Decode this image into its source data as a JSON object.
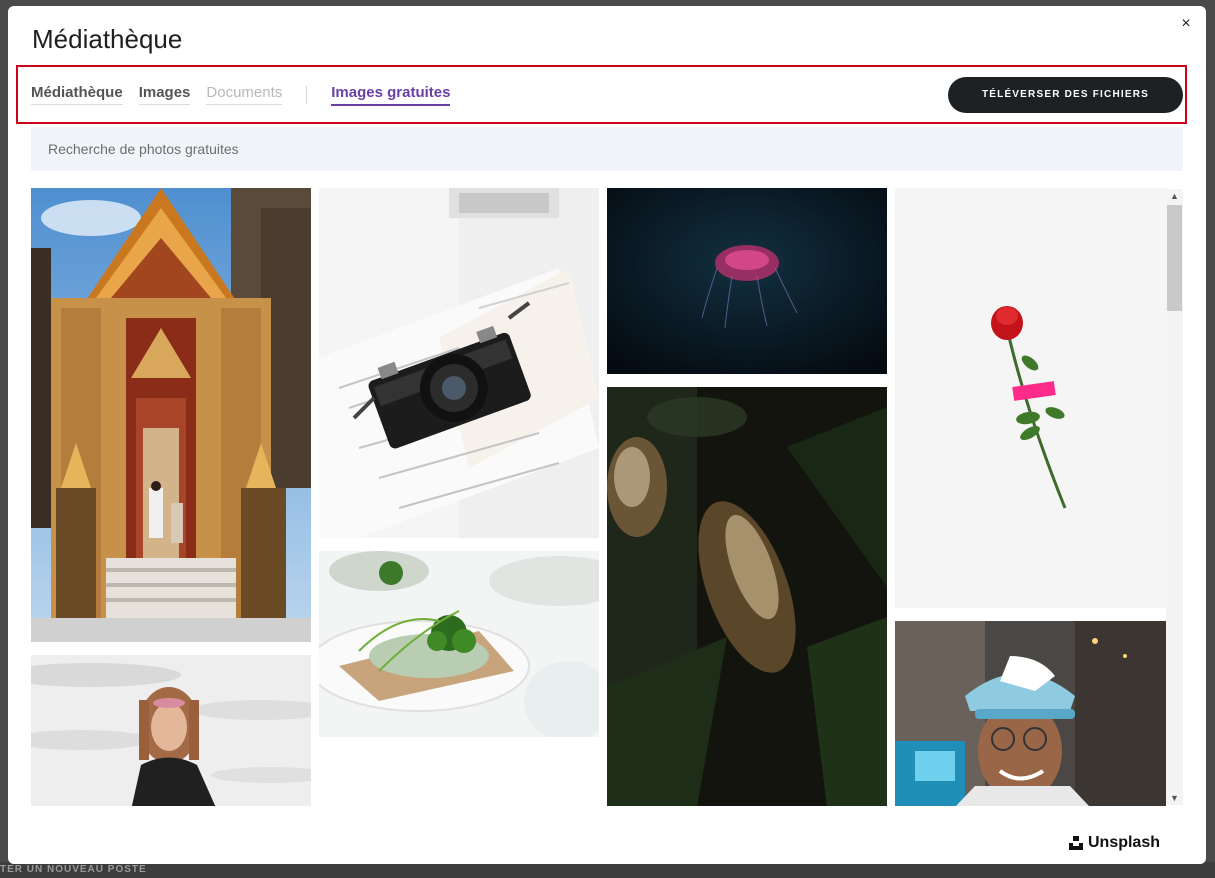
{
  "modal": {
    "title": "Médiathèque",
    "close_label": "×"
  },
  "tabs": [
    {
      "label": "Médiathèque",
      "state": "normal"
    },
    {
      "label": "Images",
      "state": "normal"
    },
    {
      "label": "Documents",
      "state": "disabled"
    },
    {
      "label": "Images gratuites",
      "state": "active"
    }
  ],
  "upload_button": {
    "label": "TÉLÉVERSER DES FICHIERS"
  },
  "search": {
    "placeholder": "Recherche de photos gratuites",
    "value": ""
  },
  "images": [
    {
      "subject": "temple",
      "column": 1
    },
    {
      "subject": "woman-portrait",
      "column": 1
    },
    {
      "subject": "camera-on-book",
      "column": 2
    },
    {
      "subject": "food-plate",
      "column": 2
    },
    {
      "subject": "jellyfish",
      "column": 3
    },
    {
      "subject": "blurred-plant",
      "column": 3
    },
    {
      "subject": "red-rose",
      "column": 4
    },
    {
      "subject": "smiling-man-cap",
      "column": 4
    }
  ],
  "brand": {
    "name": "Unsplash"
  },
  "background": {
    "footer_text": "TER UN NOUVEAU POSTE"
  },
  "colors": {
    "accent": "#6b3fa8",
    "button_bg": "#1e2124",
    "highlight_border": "#d0021b"
  }
}
